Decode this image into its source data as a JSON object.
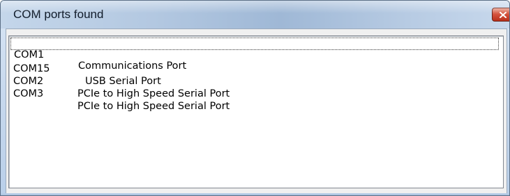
{
  "window": {
    "title": "COM ports found",
    "close_icon": "close-icon",
    "accent_color": "#c7402a"
  },
  "ports": [
    {
      "port": "COM1",
      "description": "Communications Port"
    },
    {
      "port": "COM15",
      "description": "USB Serial Port"
    },
    {
      "port": "COM2",
      "description": "PCIe to High Speed Serial Port"
    },
    {
      "port": "COM3",
      "description": "PCIe to High Speed Serial Port"
    }
  ]
}
